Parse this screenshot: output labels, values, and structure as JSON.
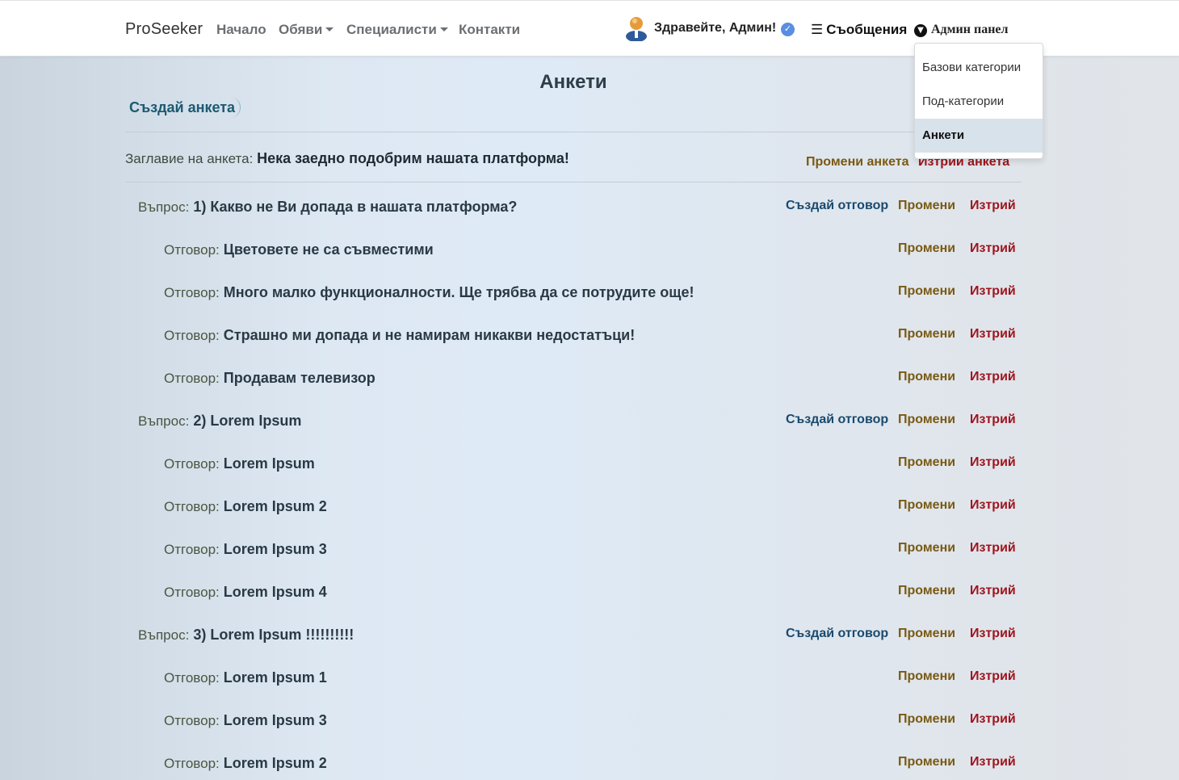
{
  "navbar": {
    "brand": "ProSeeker",
    "links": [
      "Начало",
      "Обяви",
      "Специалисти",
      "Контакти"
    ],
    "greeting": "Здравейте, Админ!",
    "messages_label": "Съобщения",
    "admin_panel_label": "Админ панел"
  },
  "dropdown": {
    "items": [
      "Базови категории",
      "Под-категории",
      "Анкети"
    ],
    "active_item": "Анкети"
  },
  "page": {
    "title": "Анкети",
    "create_survey_label": "Създай анкета"
  },
  "survey": {
    "title_label": "Заглавие на анкета:",
    "title": "Нека заедно подобрим нашата платформа!",
    "edit_label": "Промени анкета",
    "delete_label": "Изтрий анкета"
  },
  "labels": {
    "question": "Въпрос:",
    "answer": "Отговор:",
    "create_answer": "Създай отговор",
    "edit": "Промени",
    "delete": "Изтрий"
  },
  "questions": [
    {
      "text": "1) Какво не Ви допада в нашата платформа?",
      "answers": [
        "Цветовете не са съвместими",
        "Много малко функционалности. Ще трябва да се потрудите още!",
        "Страшно ми допада и не намирам никакви недостатъци!",
        "Продавам телевизор"
      ]
    },
    {
      "text": "2) Lorem Ipsum",
      "answers": [
        "Lorem Ipsum",
        "Lorem Ipsum 2",
        "Lorem Ipsum 3",
        "Lorem Ipsum 4"
      ]
    },
    {
      "text": "3) Lorem Ipsum !!!!!!!!!!",
      "answers": [
        "Lorem Ipsum 1",
        "Lorem Ipsum 3",
        "Lorem Ipsum 2"
      ]
    }
  ],
  "colors": {
    "edit": "#7a5a12",
    "delete": "#a0141e",
    "create_answer": "#1a4a6e",
    "dropdown_active_bg": "#d7e2eb"
  }
}
